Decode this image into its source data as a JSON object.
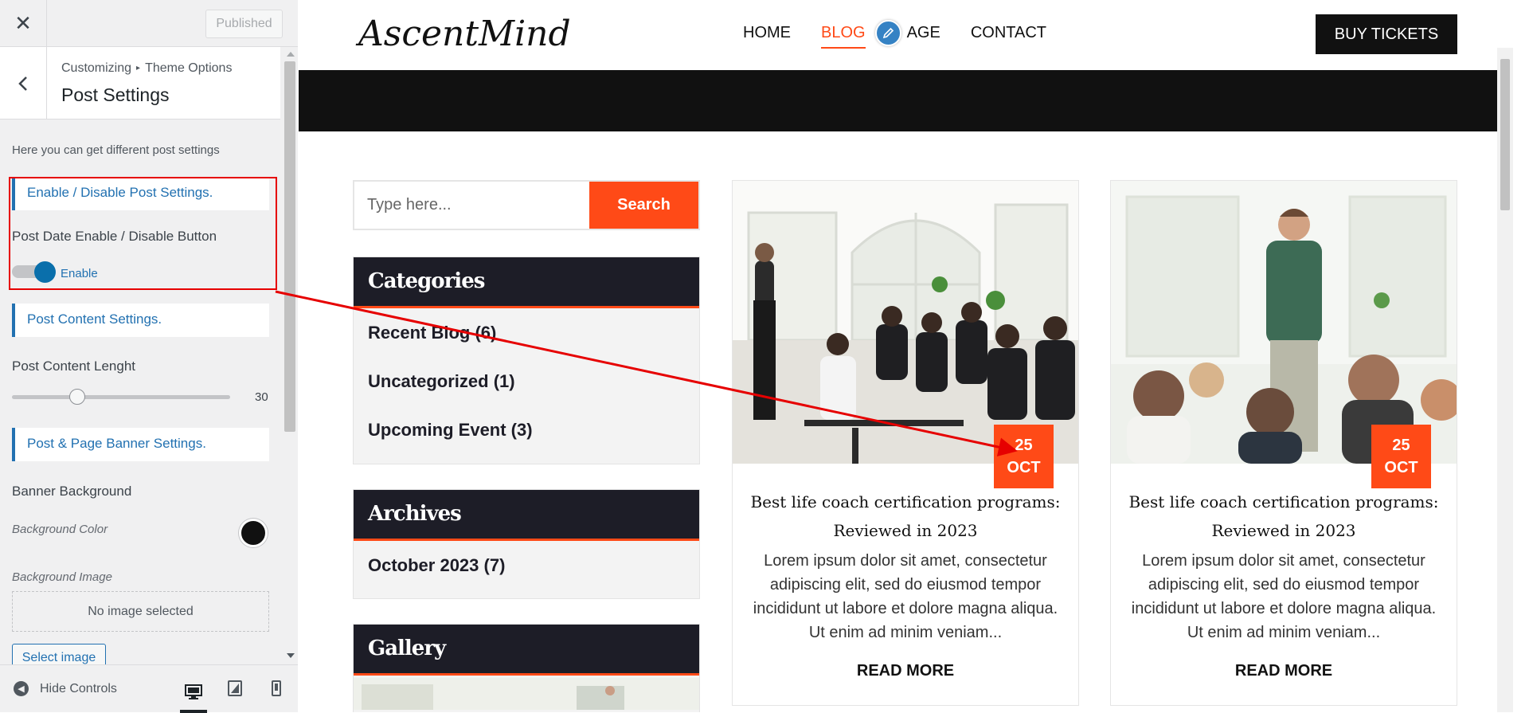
{
  "customizer": {
    "close_icon": "close-icon",
    "published_label": "Published",
    "breadcrumb": {
      "parent": "Customizing",
      "separator": "▸",
      "section": "Theme Options"
    },
    "title": "Post Settings",
    "description": "Here you can get different post settings",
    "sections": {
      "enable_disable": "Enable / Disable Post Settings.",
      "content": "Post Content Settings.",
      "banner": "Post & Page Banner Settings."
    },
    "post_date_label": "Post Date Enable / Disable Button",
    "toggle_label": "Enable",
    "toggle_on": true,
    "content_length_label": "Post Content Lenght",
    "content_length_value": "30",
    "content_length_fraction": 0.3,
    "banner_background_label": "Banner Background",
    "background_color_label": "Background Color",
    "background_color": "#111111",
    "background_image_label": "Background Image",
    "no_image_text": "No image selected",
    "select_image_label": "Select image",
    "hide_controls_label": "Hide Controls"
  },
  "site": {
    "logo": "AscentMind",
    "nav": [
      {
        "label": "HOME",
        "active": false
      },
      {
        "label": "BLOG",
        "active": true
      },
      {
        "label": "PAGE",
        "active": false
      },
      {
        "label": "CONTACT",
        "active": false
      }
    ],
    "nav_visible_page": "AGE",
    "buy_tickets": "BUY TICKETS",
    "accent_color": "#ff4a17",
    "search": {
      "placeholder": "Type here...",
      "button": "Search"
    },
    "categories": {
      "title": "Categories",
      "items": [
        "Recent Blog (6)",
        "Uncategorized (1)",
        "Upcoming Event (3)"
      ]
    },
    "archives": {
      "title": "Archives",
      "items": [
        "October 2023 (7)"
      ]
    },
    "gallery": {
      "title": "Gallery"
    },
    "posts": [
      {
        "day": "25",
        "month": "OCT",
        "title": "Best life coach certification programs: Reviewed in 2023",
        "excerpt": "Lorem ipsum dolor sit amet, consectetur adipiscing elit, sed do eiusmod tempor incididunt ut labore et dolore magna aliqua. Ut enim ad minim veniam...",
        "read_more": "READ MORE"
      },
      {
        "day": "25",
        "month": "OCT",
        "title": "Best life coach certification programs: Reviewed in 2023",
        "excerpt": "Lorem ipsum dolor sit amet, consectetur adipiscing elit, sed do eiusmod tempor incididunt ut labore et dolore magna aliqua. Ut enim ad minim veniam...",
        "read_more": "READ MORE"
      }
    ]
  }
}
